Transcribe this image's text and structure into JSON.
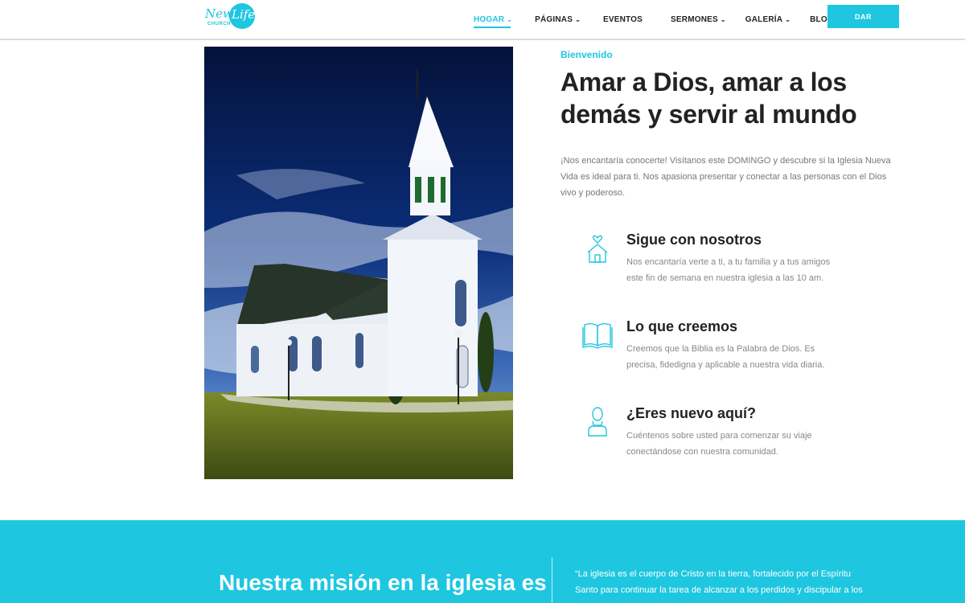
{
  "header": {
    "logo_text": "New Life CHURCH",
    "nav": [
      {
        "label": "HOGAR",
        "has_dropdown": true,
        "active": true
      },
      {
        "label": "PÁGINAS",
        "has_dropdown": true,
        "active": false
      },
      {
        "label": "EVENTOS",
        "has_dropdown": false,
        "active": false
      },
      {
        "label": "SERMONES",
        "has_dropdown": true,
        "active": false
      },
      {
        "label": "GALERÍA",
        "has_dropdown": true,
        "active": false
      },
      {
        "label": "BLOG",
        "has_dropdown": false,
        "active": false
      }
    ],
    "give_label": "DAR"
  },
  "welcome": {
    "eyebrow": "Bienvenido",
    "headline": "Amar a Dios, amar a los demás y servir al mundo",
    "intro": "¡Nos encantaría conocerte! Visítanos este DOMINGO y descubre si la Iglesia Nueva Vida es ideal para ti. Nos apasiona presentar y conectar a las personas con el Dios vivo y poderoso."
  },
  "features": [
    {
      "icon": "church-heart-icon",
      "title": "Sigue con nosotros",
      "text": "Nos encantaría verte a ti, a tu familia y a tus amigos este fin de semana en nuestra iglesia a las 10 am."
    },
    {
      "icon": "open-book-icon",
      "title": "Lo que creemos",
      "text": "Creemos que la Biblia es la Palabra de Dios. Es precisa, fidedigna y aplicable a nuestra vida diaria."
    },
    {
      "icon": "person-icon",
      "title": "¿Eres nuevo aquí?",
      "text": "Cuéntenos sobre usted para comenzar su viaje conectándose con nuestra comunidad."
    }
  ],
  "mission": {
    "title": "Nuestra misión en la iglesia es",
    "quote": "“La iglesia es el cuerpo de Cristo en la tierra, fortalecido por el Espíritu Santo para continuar la tarea de alcanzar a los perdidos y discipular a los"
  },
  "colors": {
    "accent": "#1ec6e0",
    "heading": "#222222",
    "body_text": "#777777"
  }
}
